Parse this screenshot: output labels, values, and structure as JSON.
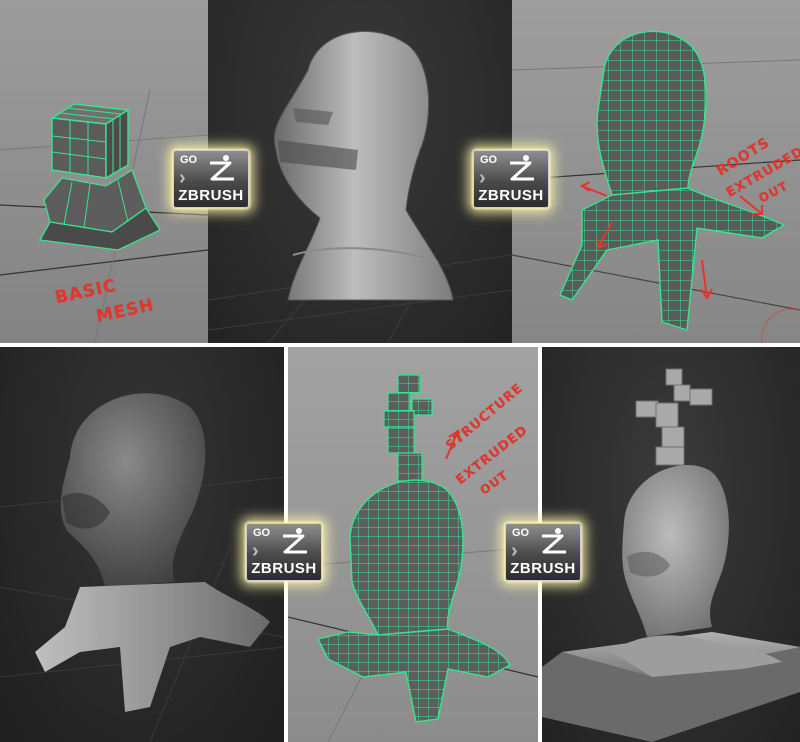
{
  "badge": {
    "go_label": "GO",
    "brand_label": "ZBRUSH"
  },
  "annotations": {
    "basic_mesh_line1": "BASIC",
    "basic_mesh_line2": "MESH",
    "roots_line1": "ROOTS",
    "roots_line2": "EXTRUDED",
    "roots_line3": "OUT",
    "structure_line1": "STRUCTURE",
    "structure_line2": "EXTRUDED",
    "structure_line3": "OUT"
  },
  "colors": {
    "wire": "#39e38f",
    "annotation_red": "#e8332a",
    "viewport_light": "#8f8f8f",
    "viewport_dark": "#2e2e2e",
    "badge_glow": "#fff4aa"
  },
  "icons": [
    "zbrush-runner-icon",
    "chevron-icon",
    "arrow-icon"
  ]
}
